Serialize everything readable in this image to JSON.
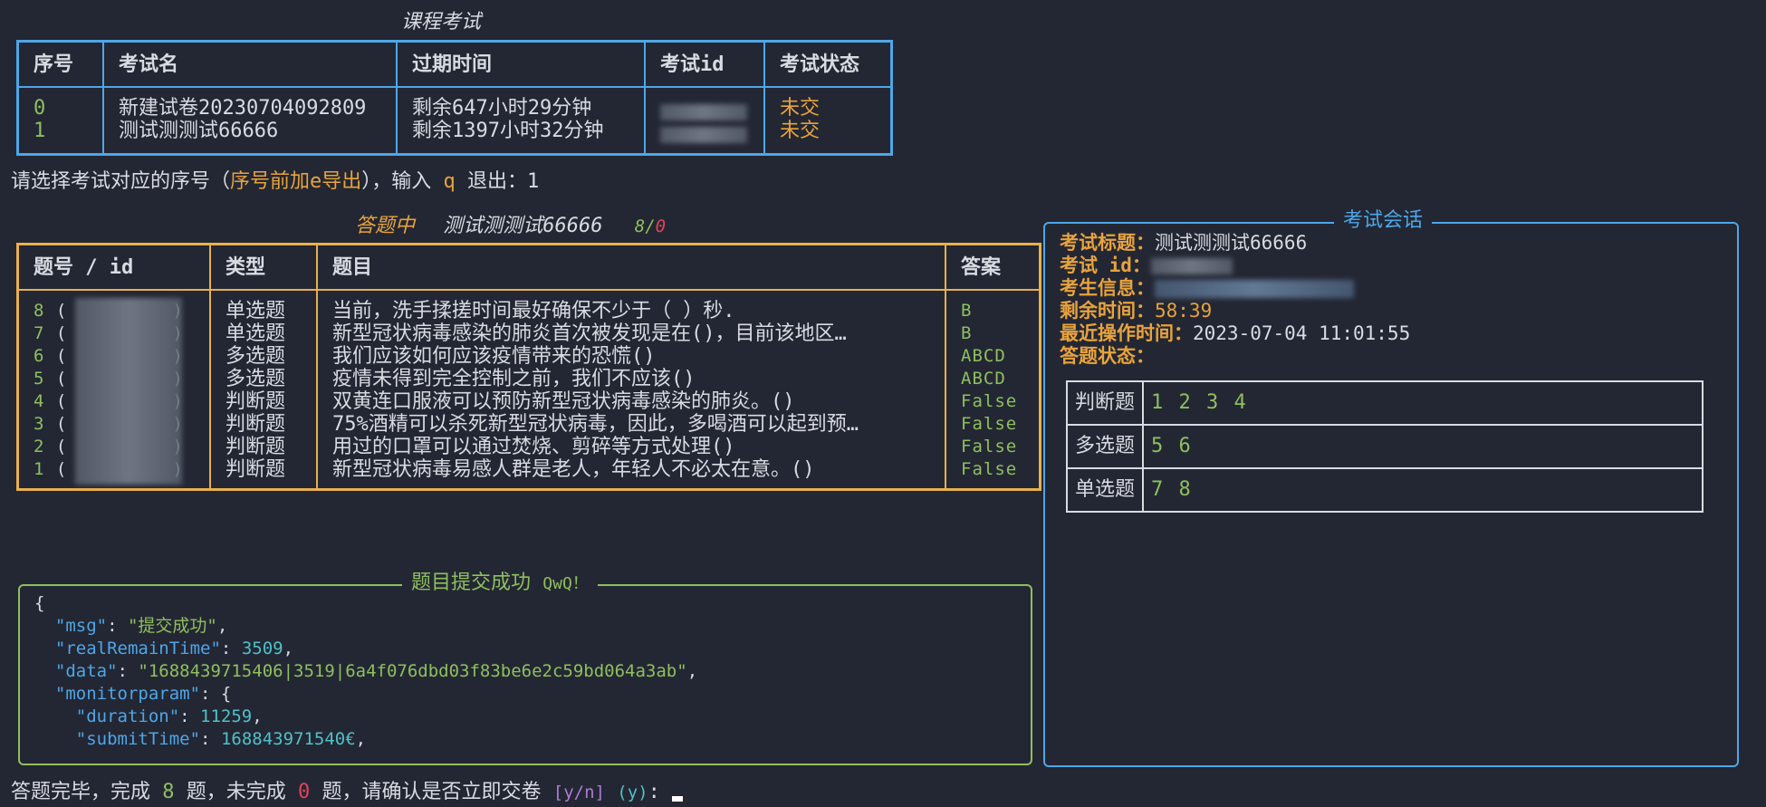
{
  "exam_list": {
    "title": "课程考试",
    "headers": [
      "序号",
      "考试名",
      "过期时间",
      "考试id",
      "考试状态"
    ],
    "rows": [
      {
        "index": "0",
        "name": "新建试卷20230704092809",
        "expire": "剩余647小时29分钟",
        "status": "未交"
      },
      {
        "index": "1",
        "name": "测试测测试66666",
        "expire": "剩余1397小时32分钟",
        "status": "未交"
      }
    ]
  },
  "prompt": {
    "text_before": "请选择考试对应的序号（",
    "hint": "序号前加e导出",
    "text_middle": "），输入",
    "quit_key": "q",
    "text_after": "退出：",
    "input_value": "1"
  },
  "answering": {
    "title": "答题中",
    "exam_name": "测试测测试66666",
    "progress_done": "8",
    "progress_sep": "/",
    "progress_fail": "0"
  },
  "questions": {
    "headers": [
      "题号 / id",
      "类型",
      "题目",
      "答案"
    ],
    "rows": [
      {
        "no": "8",
        "id_open": "(",
        "id_close": ")",
        "type": "单选题",
        "text": "当前，洗手揉搓时间最好确保不少于（ ）秒.",
        "answer": "B"
      },
      {
        "no": "7",
        "id_open": "(",
        "id_close": ")",
        "type": "单选题",
        "text": "新型冠状病毒感染的肺炎首次被发现是在()，目前该地区…",
        "answer": "B"
      },
      {
        "no": "6",
        "id_open": "(",
        "id_close": ")",
        "type": "多选题",
        "text": "我们应该如何应该疫情带来的恐慌()",
        "answer": "ABCD"
      },
      {
        "no": "5",
        "id_open": "(",
        "id_close": ")",
        "type": "多选题",
        "text": "疫情未得到完全控制之前，我们不应该()",
        "answer": "ABCD"
      },
      {
        "no": "4",
        "id_open": "(",
        "id_close": ")",
        "type": "判断题",
        "text": "双黄连口服液可以预防新型冠状病毒感染的肺炎。()",
        "answer": "False"
      },
      {
        "no": "3",
        "id_open": "(",
        "id_close": ")",
        "type": "判断题",
        "text": "75%酒精可以杀死新型冠状病毒，因此，多喝酒可以起到预…",
        "answer": "False"
      },
      {
        "no": "2",
        "id_open": "(",
        "id_close": ")",
        "type": "判断题",
        "text": "用过的口罩可以通过焚烧、剪碎等方式处理()",
        "answer": "False"
      },
      {
        "no": "1",
        "id_open": "(",
        "id_close": ")",
        "type": "判断题",
        "text": "新型冠状病毒易感人群是老人，年轻人不必太在意。()",
        "answer": "False"
      }
    ]
  },
  "submit_panel": {
    "title": "题目提交成功",
    "title_suffix": "QwQ！",
    "json_lines": {
      "open": "{",
      "msg_key": "\"msg\"",
      "msg_val": "\"提交成功\"",
      "rrt_key": "\"realRemainTime\"",
      "rrt_val": "3509",
      "data_key": "\"data\"",
      "data_val": "\"1688439715406|3519|6a4f076dbd03f83be6e2c59bd064a3ab\"",
      "mp_key": "\"monitorparam\"",
      "dur_key": "\"duration\"",
      "dur_val": "11259",
      "st_key": "\"submitTime\"",
      "st_val": "168843971540€"
    }
  },
  "session": {
    "title": "考试会话",
    "exam_title_label": "考试标题：",
    "exam_title_value": "测试测测试66666",
    "exam_id_label": "考试 id：",
    "student_label": "考生信息：",
    "remain_label": "剩余时间：",
    "remain_value": "58:39",
    "last_op_label": "最近操作时间：",
    "last_op_value": "2023-07-04 11:01:55",
    "answer_status_label": "答题状态：",
    "status_rows": [
      {
        "type": "判断题",
        "nums": "1  2  3  4"
      },
      {
        "type": "多选题",
        "nums": "5  6"
      },
      {
        "type": "单选题",
        "nums": "7  8"
      }
    ]
  },
  "footer": {
    "text1": "答题完毕，完成",
    "done_count": "8",
    "text2": "题，未完成",
    "undone_count": "0",
    "text3": "题，请确认是否立即交卷",
    "options": "[y/n]",
    "default": "(y)",
    "colon": ":"
  },
  "colors": {
    "background": "#232733",
    "exam_table_border": "#4ea6e8",
    "question_table_border": "#e8b04c",
    "submit_frame": "#8fbf5f",
    "session_frame": "#4ea6e8"
  }
}
